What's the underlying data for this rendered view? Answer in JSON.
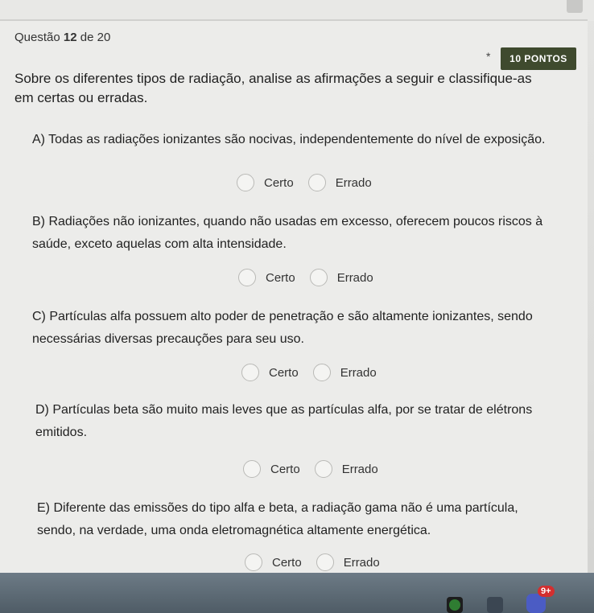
{
  "header": {
    "question_prefix": "Questão",
    "question_number": "12",
    "question_suffix": "de 20",
    "asterisk": "*",
    "points": "10 PONTOS"
  },
  "statement": "Sobre os diferentes tipos de radiação, analise as afirmações a seguir e classifique-as em certas ou erradas.",
  "items": [
    {
      "text": "A) Todas as radiações ionizantes são nocivas, independentemente do nível de exposição.",
      "option_true": "Certo",
      "option_false": "Errado"
    },
    {
      "text": "B) Radiações não ionizantes, quando não usadas em excesso, oferecem poucos riscos à saúde, exceto aquelas com alta intensidade.",
      "option_true": "Certo",
      "option_false": "Errado"
    },
    {
      "text": "C) Partículas alfa possuem alto poder de penetração e são altamente ionizantes, sendo necessárias diversas precauções para seu uso.",
      "option_true": "Certo",
      "option_false": "Errado"
    },
    {
      "text": "D) Partículas beta são muito mais leves que as partículas alfa, por se tratar de elétrons emitidos.",
      "option_true": "Certo",
      "option_false": "Errado"
    },
    {
      "text": "E) Diferente das emissões do tipo alfa e beta, a radiação gama não é uma partícula, sendo, na verdade, uma onda eletromagnética altamente energética.",
      "option_true": "Certo",
      "option_false": "Errado"
    }
  ],
  "taskbar": {
    "icons": [
      "xbox-icon",
      "game-icon",
      "discord-icon"
    ],
    "notification_count": "9+"
  },
  "colors": {
    "badge_bg": "#3f4a2e",
    "card_bg": "#ececea",
    "taskbar_bg": "#5a6772"
  }
}
